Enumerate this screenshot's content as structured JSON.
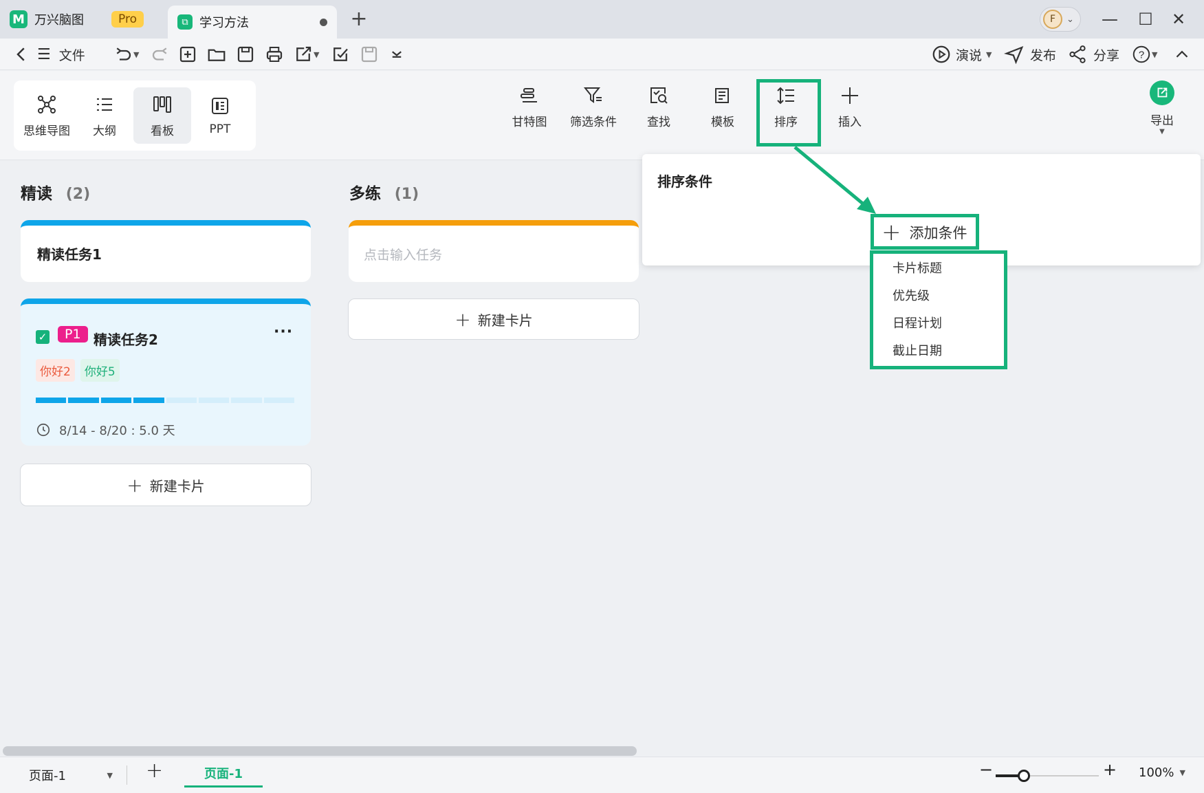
{
  "app": {
    "name": "万兴脑图",
    "badge": "Pro"
  },
  "tab": {
    "title": "学习方法"
  },
  "menu": {
    "file": "文件",
    "present": "演说",
    "publish": "发布",
    "share": "分享"
  },
  "views": [
    {
      "label": "思维导图"
    },
    {
      "label": "大纲"
    },
    {
      "label": "看板"
    },
    {
      "label": "PPT"
    }
  ],
  "tools": {
    "gantt": "甘特图",
    "filter": "筛选条件",
    "find": "查找",
    "template": "模板",
    "sort": "排序",
    "insert": "插入",
    "export": "导出"
  },
  "columns": [
    {
      "title": "精读",
      "count": "(2)",
      "cards": [
        {
          "title": "精读任务1"
        },
        {
          "priority": "P1",
          "title": "精读任务2",
          "tags": [
            "你好2",
            "你好5"
          ],
          "progress_filled": 4,
          "progress_total": 8,
          "date": "8/14 - 8/20 : 5.0 天"
        }
      ],
      "new_card": "新建卡片"
    },
    {
      "title": "多练",
      "count": "(1)",
      "cards": [
        {
          "placeholder": "点击输入任务"
        }
      ],
      "new_card": "新建卡片"
    }
  ],
  "sort_panel": {
    "title": "排序条件",
    "add_condition": "添加条件",
    "options": [
      "卡片标题",
      "优先级",
      "日程计划",
      "截止日期"
    ]
  },
  "bottom": {
    "page_select": "页面-1",
    "page_tab": "页面-1",
    "zoom": "100%"
  },
  "colors": {
    "accent": "#16b27b",
    "blue": "#0ea5e9",
    "orange": "#f59e0b",
    "priority": "#ec1f8c"
  }
}
